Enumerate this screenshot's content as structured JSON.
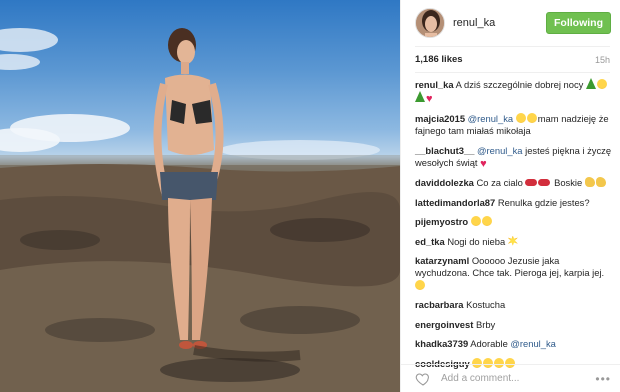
{
  "post": {
    "photo_alt": "",
    "header": {
      "username": "renul_ka",
      "follow_label": "Following"
    },
    "likes": "1,186 likes",
    "time": "15h",
    "comments": [
      {
        "author": "renul_ka",
        "text": "A dziś szczególnie dobrej nocy",
        "emojis": [
          "tree",
          "smile",
          "tree",
          "heart"
        ]
      },
      {
        "author": "majcia2015",
        "mention": "@renul_ka",
        "text": "mam nadzieję że fajnego tam miałaś mikołaja",
        "emojis_before": [
          "smile",
          "smile"
        ]
      },
      {
        "author": "__blachut3__",
        "mention": "@renul_ka",
        "text": "jesteś piękna i życzę wesołych świąt",
        "emojis": [
          "heart"
        ]
      },
      {
        "author": "daviddolezka",
        "text": "Co za cialo",
        "text2": "Boskie",
        "emojis_mid": [
          "lips",
          "lips"
        ],
        "emojis": [
          "muscle",
          "muscle"
        ]
      },
      {
        "author": "lattedimandorla87",
        "text": "Renulka gdzie jestes?"
      },
      {
        "author": "pijemyostro",
        "text": "",
        "emojis": [
          "heart-eyes",
          "smile"
        ]
      },
      {
        "author": "ed_tka",
        "text": "Nogi do nieba",
        "emojis": [
          "boom"
        ]
      },
      {
        "author": "katarzynaml",
        "text": "Oooooo Jezusie jaka wychudzona. Chce tak. Pieroga jej, karpia jej.",
        "emojis": [
          "smile"
        ]
      },
      {
        "author": "racbarbara",
        "text": "Kostucha"
      },
      {
        "author": "energoinvest",
        "text": "Brby"
      },
      {
        "author": "khadka3739",
        "text": "Adorable",
        "mention_after": "@renul_ka"
      },
      {
        "author": "cooldesiguy",
        "text": "",
        "emojis": [
          "heart-eyes",
          "heart-eyes",
          "heart-eyes",
          "heart-eyes"
        ]
      }
    ],
    "footer": {
      "add_comment_placeholder": "Add a comment...",
      "more_label": "•••"
    }
  }
}
